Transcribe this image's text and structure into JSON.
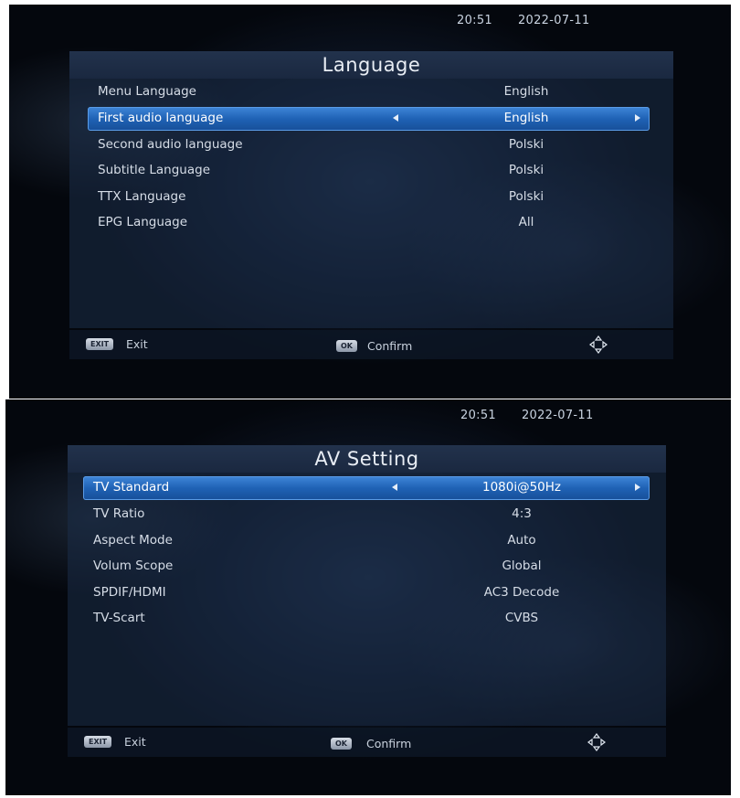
{
  "screens": [
    {
      "clock": {
        "time": "20:51",
        "date": "2022-07-11"
      },
      "title": "Language",
      "rows": [
        {
          "label": "Menu Language",
          "value": "English"
        },
        {
          "label": "First audio language",
          "value": "English",
          "selected": true
        },
        {
          "label": "Second audio language",
          "value": "Polski"
        },
        {
          "label": "Subtitle Language",
          "value": "Polski"
        },
        {
          "label": "TTX Language",
          "value": "Polski"
        },
        {
          "label": "EPG Language",
          "value": "All"
        }
      ],
      "footer": {
        "exit_key": "EXIT",
        "exit_label": "Exit",
        "ok_key": "OK",
        "ok_label": "Confirm",
        "nav_icon": "dpad-arrows-icon"
      }
    },
    {
      "clock": {
        "time": "20:51",
        "date": "2022-07-11"
      },
      "title": "AV Setting",
      "rows": [
        {
          "label": "TV Standard",
          "value": "1080i@50Hz",
          "selected": true
        },
        {
          "label": "TV Ratio",
          "value": "4:3"
        },
        {
          "label": "Aspect Mode",
          "value": "Auto"
        },
        {
          "label": "Volum Scope",
          "value": "Global"
        },
        {
          "label": "SPDIF/HDMI",
          "value": "AC3 Decode"
        },
        {
          "label": "TV-Scart",
          "value": "CVBS"
        }
      ],
      "footer": {
        "exit_key": "EXIT",
        "exit_label": "Exit",
        "ok_key": "OK",
        "ok_label": "Confirm",
        "nav_icon": "dpad-arrows-icon"
      }
    }
  ],
  "colors": {
    "highlight": "#1f62b5",
    "panel": "#1c2e48",
    "text": "#d6dde7"
  }
}
